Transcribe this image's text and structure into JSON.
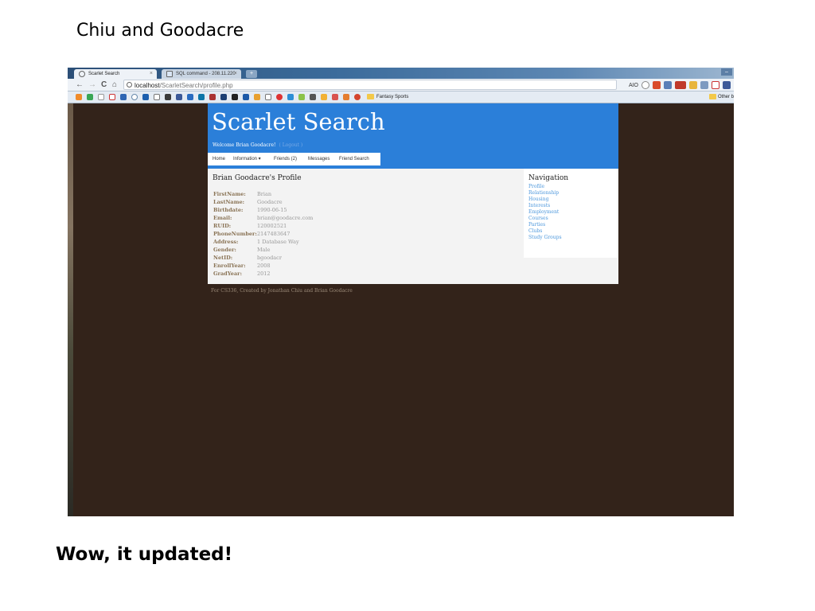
{
  "slide": {
    "title": "Chiu and Goodacre",
    "caption": "Wow, it updated!"
  },
  "browser": {
    "tabs": [
      {
        "label": "Scarlet Search"
      },
      {
        "label": "SQL command - 208.11.220"
      }
    ],
    "tab_close": "×",
    "new_tab": "+",
    "window_control": "–",
    "nav": {
      "back": "←",
      "forward": "→",
      "reload": "C",
      "home": "⌂"
    },
    "address": {
      "host": "localhost",
      "path": "/ScarletSearch/profile.php"
    },
    "extension_label": "AIO",
    "bookmarks": {
      "fantasy": "Fantasy Sports",
      "other": "Other b"
    }
  },
  "site": {
    "title": "Scarlet Search",
    "welcome": "Welcome Brian Goodacre!",
    "logout": "( Logout )",
    "menu": [
      "Home",
      "Information ▾",
      "Friends (2)",
      "Messages",
      "Friend Search"
    ]
  },
  "profile": {
    "heading": "Brian Goodacre's Profile",
    "fields": [
      {
        "label": "FirstName:",
        "value": "Brian"
      },
      {
        "label": "LastName:",
        "value": "Goodacre"
      },
      {
        "label": "Birthdate:",
        "value": "1990-06-15"
      },
      {
        "label": "Email:",
        "value": "brian@goodacre.com"
      },
      {
        "label": "RUID:",
        "value": "120002521"
      },
      {
        "label": "PhoneNumber:",
        "value": "2147483647"
      },
      {
        "label": "Address:",
        "value": "1 Database Way"
      },
      {
        "label": "Gender:",
        "value": "Male"
      },
      {
        "label": "NetID:",
        "value": "bgoodacr"
      },
      {
        "label": "EnrollYear:",
        "value": "2008"
      },
      {
        "label": "GradYear:",
        "value": "2012"
      }
    ]
  },
  "navigation": {
    "heading": "Navigation",
    "links": [
      "Profile",
      "Relationship",
      "Housing",
      "Interests",
      "Employment",
      "Courses",
      "Parties",
      "Clubs",
      "Study Groups"
    ]
  },
  "footer": "For CS336, Created by Jonathan Chiu and Brian Goodacre",
  "colors": {
    "header_blue": "#2b7fd9",
    "page_background": "#33231a",
    "link_blue": "#4c97dc",
    "label_brown": "#8a7456"
  }
}
